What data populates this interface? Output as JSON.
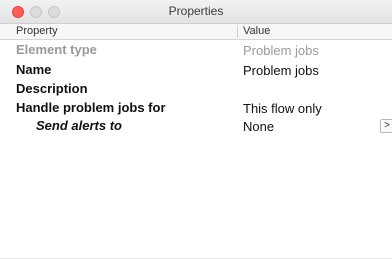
{
  "window": {
    "title": "Properties"
  },
  "table": {
    "header": {
      "property": "Property",
      "value": "Value"
    },
    "rows": [
      {
        "property": "Element type",
        "value": "Problem jobs"
      },
      {
        "property": "Name",
        "value": "Problem jobs"
      },
      {
        "property": "Description",
        "value": ""
      },
      {
        "property": "Handle problem jobs for",
        "value": "This flow only"
      },
      {
        "property": "Send alerts to",
        "value": "None",
        "button": ">"
      }
    ]
  }
}
